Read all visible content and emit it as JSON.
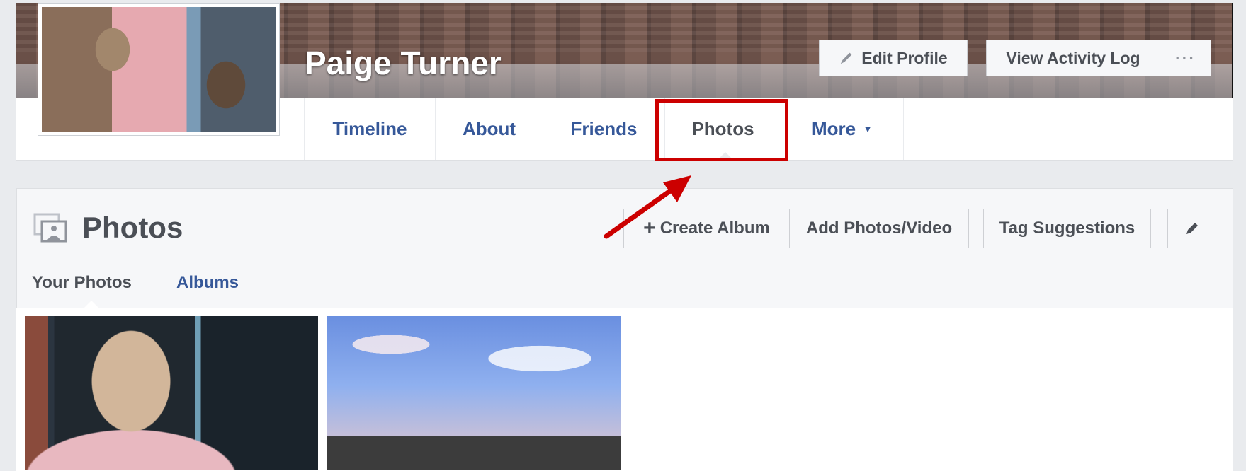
{
  "profile": {
    "name": "Paige Turner",
    "edit_profile_label": "Edit Profile",
    "view_activity_log_label": "View Activity Log",
    "more_options_label": "···"
  },
  "nav": {
    "tabs": [
      {
        "label": "Timeline"
      },
      {
        "label": "About"
      },
      {
        "label": "Friends"
      },
      {
        "label": "Photos",
        "active": true
      },
      {
        "label": "More"
      }
    ]
  },
  "photos_section": {
    "title": "Photos",
    "create_album_label": "Create Album",
    "add_photos_label": "Add Photos/Video",
    "tag_suggestions_label": "Tag Suggestions",
    "subtabs": [
      {
        "label": "Your Photos",
        "active": true
      },
      {
        "label": "Albums"
      }
    ]
  },
  "annotation": {
    "highlight_color": "#cc0000"
  },
  "colors": {
    "link_blue": "#365899",
    "text_dark": "#4b4f56",
    "page_bg": "#e9ebee"
  }
}
